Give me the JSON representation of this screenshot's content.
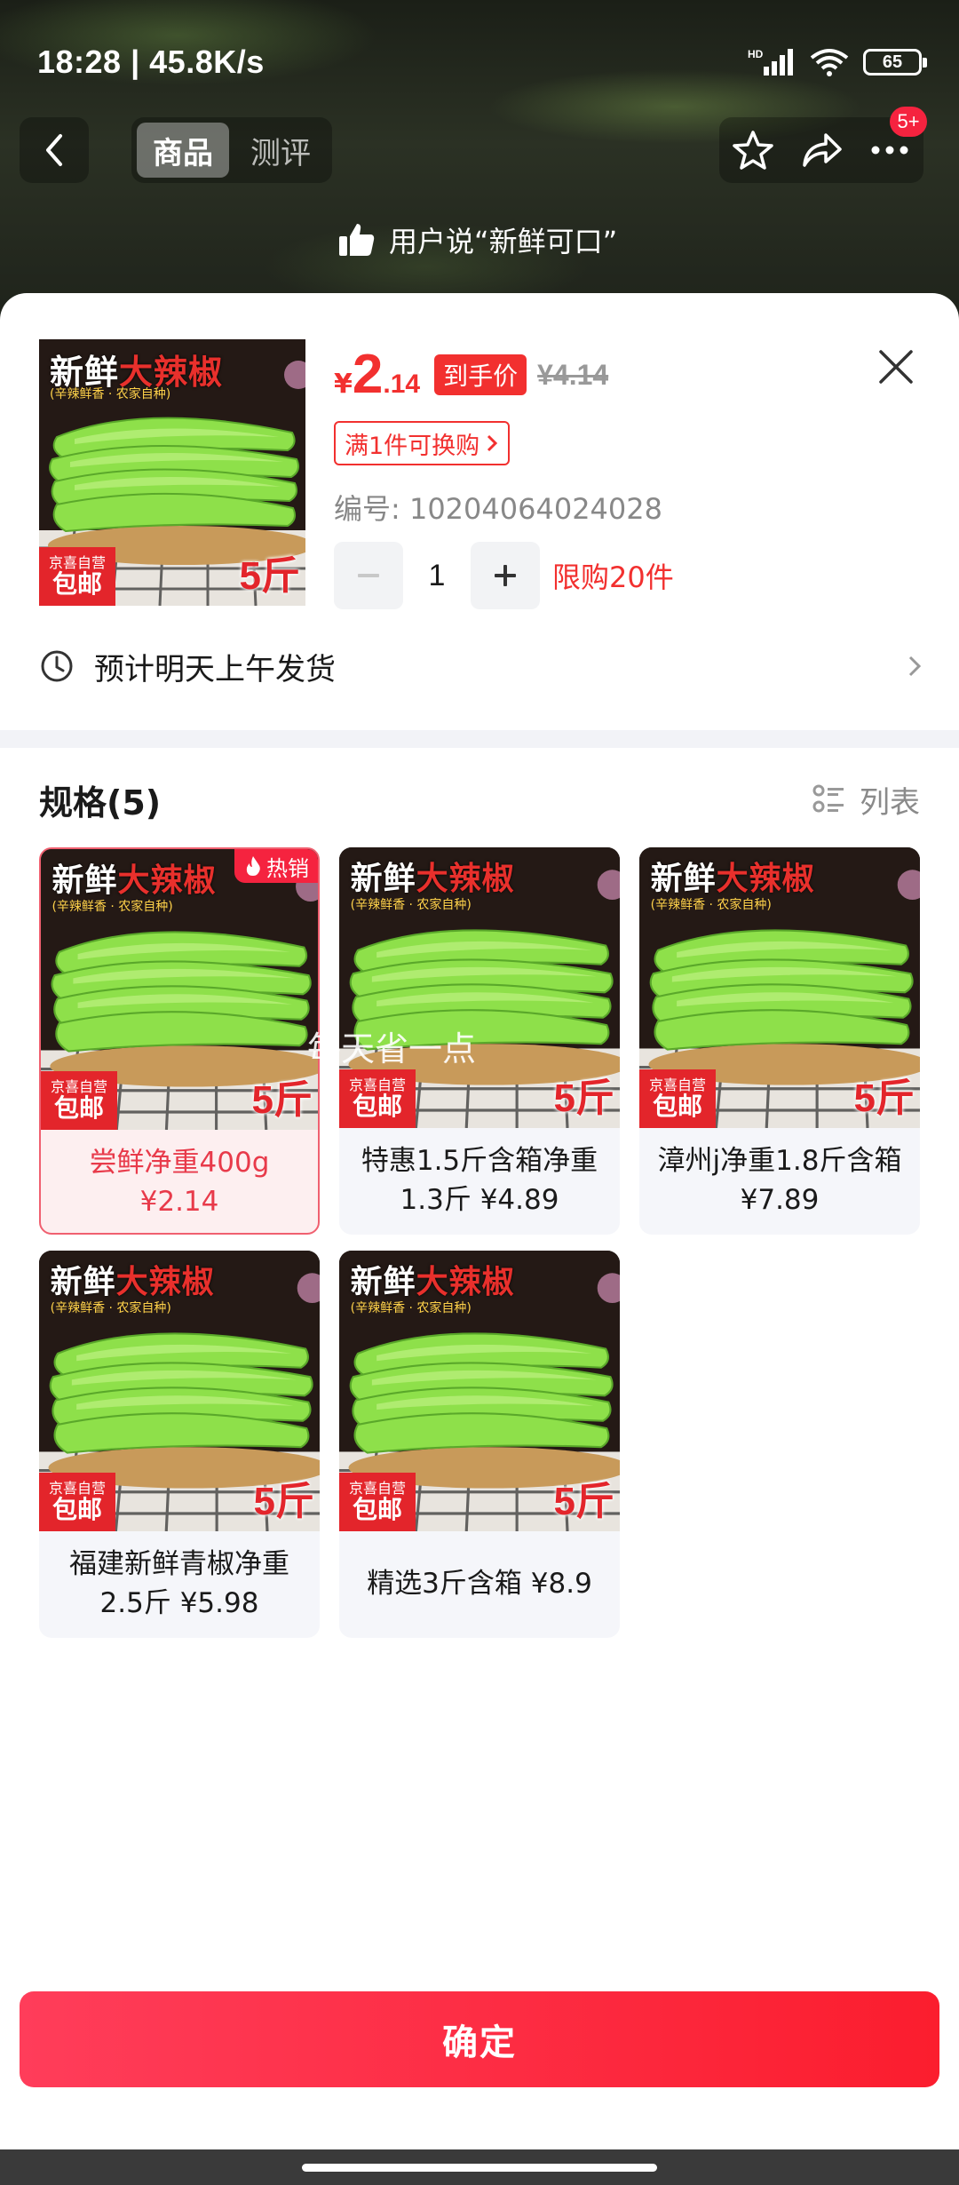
{
  "status": {
    "time_speed": "18:28 | 45.8K/s",
    "battery": "65",
    "network": "HD"
  },
  "nav": {
    "tabs": [
      {
        "label": "商品"
      },
      {
        "label": "测评"
      }
    ],
    "cart_badge": "5+"
  },
  "background": {
    "faint_text": "…",
    "review_quote": "用户说“新鲜可口”"
  },
  "product": {
    "image_title_a": "新鲜",
    "image_title_b": "大辣椒",
    "image_sub": "(辛辣鲜香 · 农家自种)",
    "image_tag_small": "京喜自营",
    "image_tag_big": "包邮",
    "image_weight": "5斤",
    "price_symbol": "¥",
    "price_int": "2",
    "price_dec": ".14",
    "price_tag": "到手价",
    "price_original": "¥4.14",
    "promo": "满1件可换购",
    "sku_id": "编号: 10204064024028",
    "quantity": "1",
    "limit": "限购20件"
  },
  "shipping": {
    "text": "预计明天上午发货"
  },
  "specs": {
    "title": "规格(5)",
    "toggle_label": "列表",
    "hot_label": "热销",
    "watermark": "每天省一点",
    "items": [
      {
        "line1": "尝鲜净重400g",
        "line2": "¥2.14",
        "selected": true
      },
      {
        "line1": "特惠1.5斤含箱净重",
        "line2": "1.3斤  ¥4.89",
        "selected": false
      },
      {
        "line1": "漳州j净重1.8斤含箱",
        "line2": "¥7.89",
        "selected": false
      },
      {
        "line1": "福建新鲜青椒净重",
        "line2": "2.5斤  ¥5.98",
        "selected": false
      },
      {
        "line1": "精选3斤含箱  ¥8.9",
        "line2": "",
        "selected": false
      }
    ]
  },
  "footer": {
    "confirm_label": "确定"
  },
  "colors": {
    "accent": "#f2302f",
    "button": "#fb1d2e"
  }
}
